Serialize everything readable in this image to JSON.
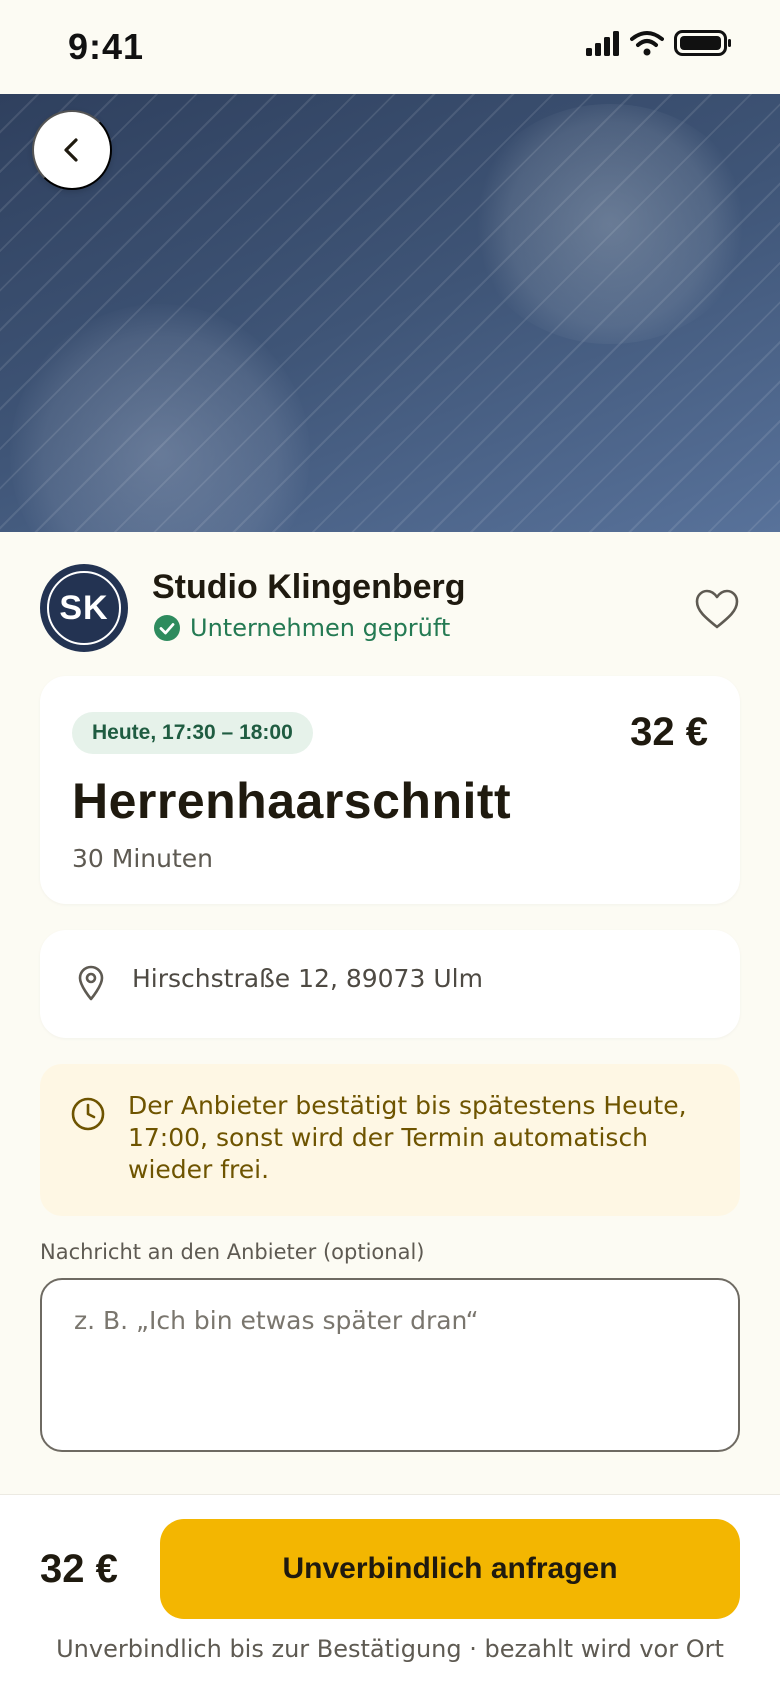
{
  "status_bar": {
    "time": "9:41"
  },
  "provider": {
    "initials": "SK",
    "name": "Studio Klingenberg",
    "verified_label": "Unternehmen geprüft"
  },
  "service": {
    "time_badge": "Heute, 17:30 – 18:00",
    "price": "32 €",
    "title": "Herrenhaarschnitt",
    "duration": "30 Minuten"
  },
  "address": {
    "text": "Hirschstraße 12, 89073 Ulm"
  },
  "notice": {
    "text": "Der Anbieter bestätigt bis spätestens Heute, 17:00, sonst wird der Termin automatisch wieder frei."
  },
  "message": {
    "label": "Nachricht an den Anbieter (optional)",
    "value": "",
    "placeholder": "z. B. „Ich bin etwas später dran“"
  },
  "footer": {
    "price": "32 €",
    "cta_label": "Unverbindlich anfragen",
    "note": "Unverbindlich bis zur Bestätigung · bezahlt wird vor Ort"
  },
  "colors": {
    "accent": "#F3B601",
    "verified_green": "#247A53",
    "avatar_navy": "#233352",
    "notice_bg": "#FEF7E4",
    "notice_text": "#6E5400",
    "background": "#FCFBF3"
  },
  "icons": [
    "signal-icon",
    "wifi-icon",
    "battery-icon",
    "back-arrow-icon",
    "check-circle-icon",
    "heart-icon",
    "location-pin-icon",
    "clock-icon"
  ]
}
